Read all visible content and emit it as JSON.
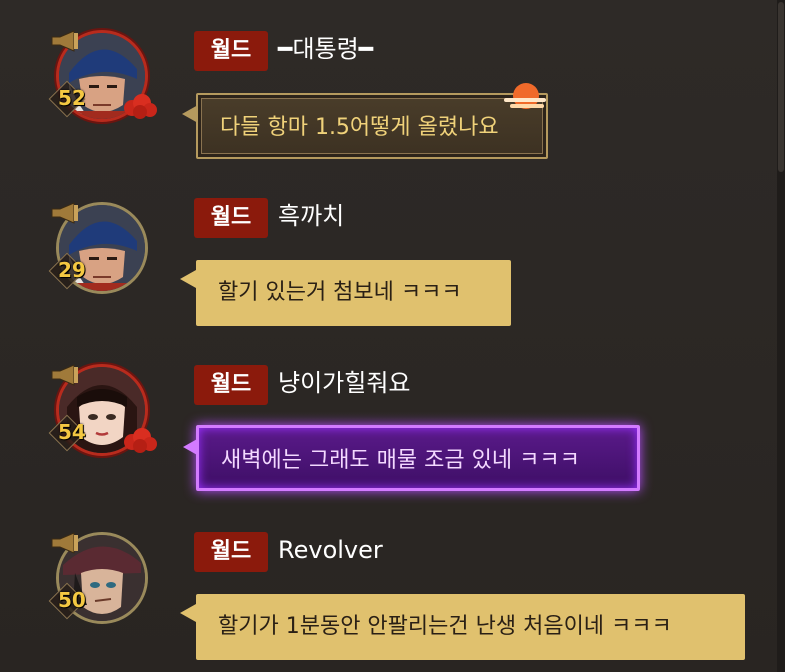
{
  "channel_tag": "월드",
  "messages": [
    {
      "username": "━대통령━",
      "level": "52",
      "text": "다들 항마 1.5어떻게 올렸나요",
      "bubble_style": "ornate",
      "avatar": "blue-bandana-warrior-portrait",
      "frame": "red-cloud-frame"
    },
    {
      "username": "흑까치",
      "level": "29",
      "text": "할기 있는거 첨보네 ㅋㅋㅋ",
      "bubble_style": "plain",
      "avatar": "blue-bandana-warrior-portrait",
      "frame": "gold-frame"
    },
    {
      "username": "냥이가힐줘요",
      "level": "54",
      "text": "새벽에는 그래도 매물 조금 있네 ㅋㅋㅋ",
      "bubble_style": "purple-glow",
      "avatar": "female-portrait",
      "frame": "red-cloud-frame"
    },
    {
      "username": "Revolver",
      "level": "50",
      "text": "할기가 1분동안 안팔리는건 난생 처음이네 ㅋㅋㅋ",
      "bubble_style": "plain",
      "avatar": "gunner-hat-portrait",
      "frame": "gold-frame"
    }
  ],
  "colors": {
    "background": "#2b2724",
    "tag": "#8b1a0c",
    "level": "#f4c842",
    "plain_bubble": "#e0c16e",
    "purple_bubble": "#5a1a8a"
  }
}
